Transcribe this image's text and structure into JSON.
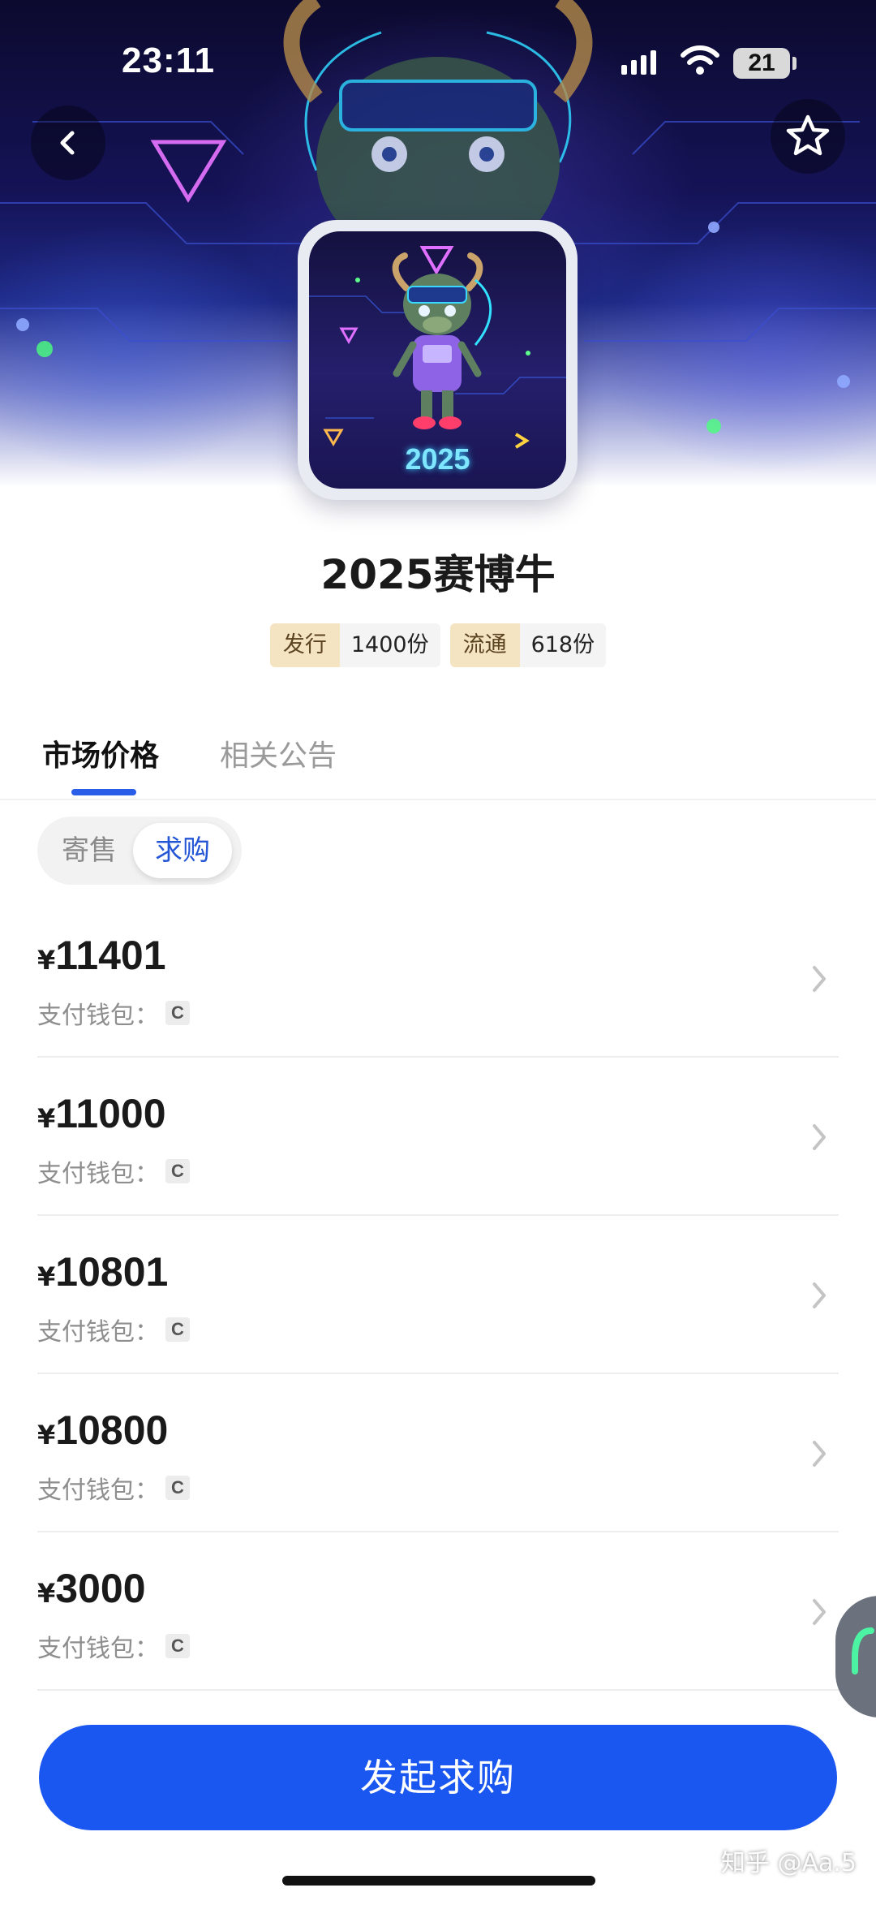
{
  "status_bar": {
    "time": "23:11",
    "battery": "21",
    "signal_icon": "signal-bars-icon",
    "wifi_icon": "wifi-icon"
  },
  "header": {
    "back_icon": "chevron-left-icon",
    "favorite_icon": "star-outline-icon"
  },
  "cover": {
    "year_text": "2025"
  },
  "collection": {
    "title": "2025赛博牛",
    "issue_label": "发行",
    "issue_value": "1400份",
    "circulation_label": "流通",
    "circulation_value": "618份"
  },
  "tabs": {
    "market_price": "市场价格",
    "notices": "相关公告",
    "active": "market_price"
  },
  "segment": {
    "consign": "寄售",
    "buy": "求购",
    "active": "buy"
  },
  "listings": [
    {
      "symbol": "¥",
      "price": "11401",
      "wallet_label": "支付钱包：",
      "wallet_badge": "C"
    },
    {
      "symbol": "¥",
      "price": "11000",
      "wallet_label": "支付钱包：",
      "wallet_badge": "C"
    },
    {
      "symbol": "¥",
      "price": "10801",
      "wallet_label": "支付钱包：",
      "wallet_badge": "C"
    },
    {
      "symbol": "¥",
      "price": "10800",
      "wallet_label": "支付钱包：",
      "wallet_badge": "C"
    },
    {
      "symbol": "¥",
      "price": "3000",
      "wallet_label": "支付钱包：",
      "wallet_badge": "C"
    }
  ],
  "cta": {
    "label": "发起求购"
  },
  "watermark": "知乎 @Aa.5",
  "colors": {
    "accent": "#1a56f0",
    "tab_indicator": "#2a5ee8",
    "tag_label_bg": "#f4e4c2"
  }
}
